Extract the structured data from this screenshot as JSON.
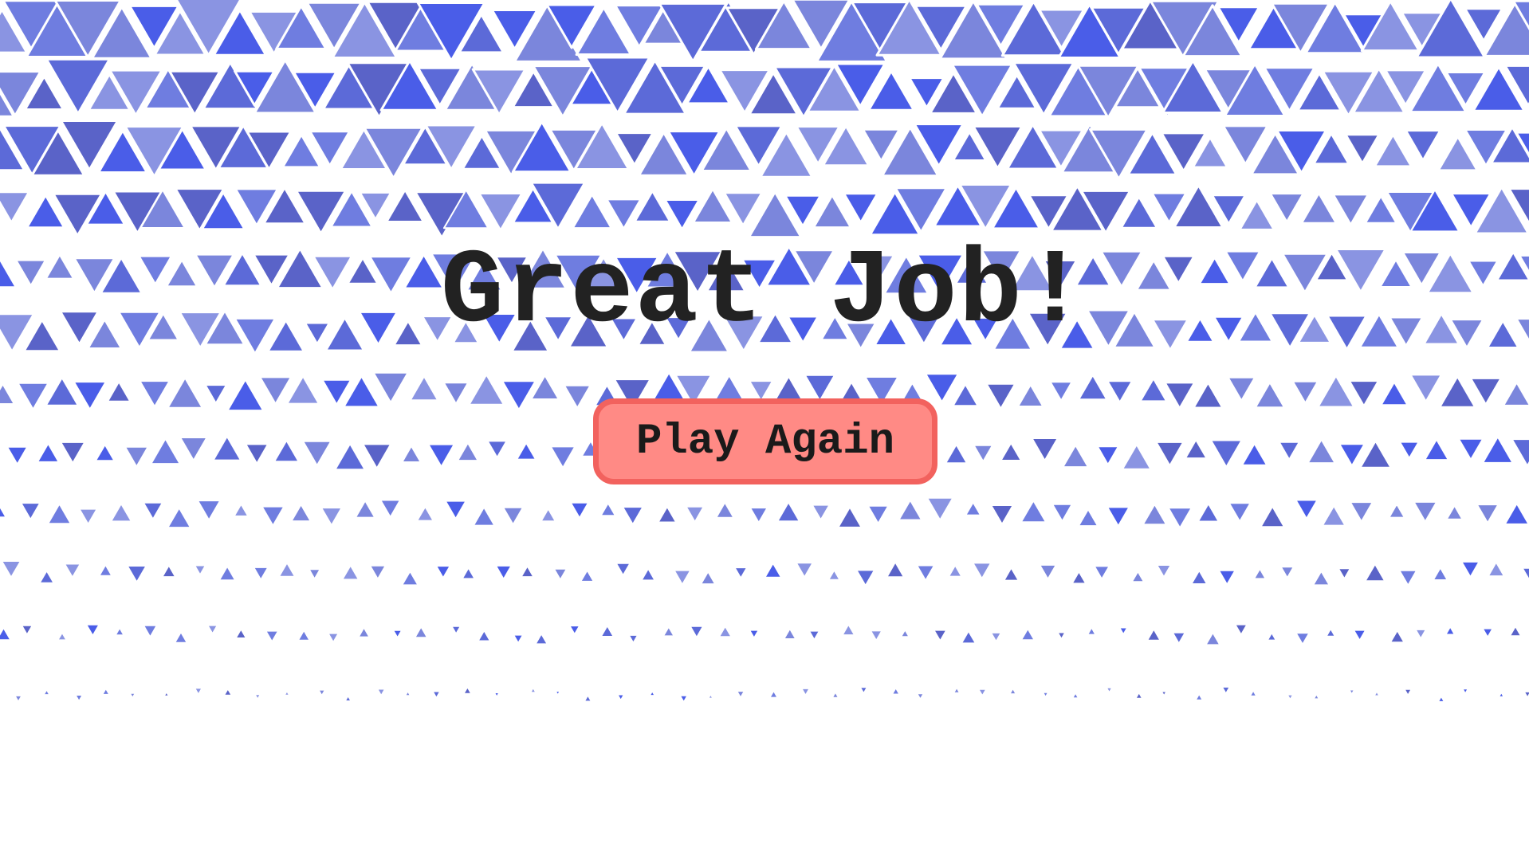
{
  "screen": {
    "title": "Great Job!",
    "play_again_label": "Play Again"
  },
  "colors": {
    "background": "#ffffff",
    "title_text": "#222222",
    "button_fill": "#ff8a85",
    "button_border": "#f2625e",
    "triangle_palette": [
      "#4a5de8",
      "#5c6ad8",
      "#6f7de0",
      "#8a94e2",
      "#5a63c8",
      "#7b86dc"
    ]
  }
}
